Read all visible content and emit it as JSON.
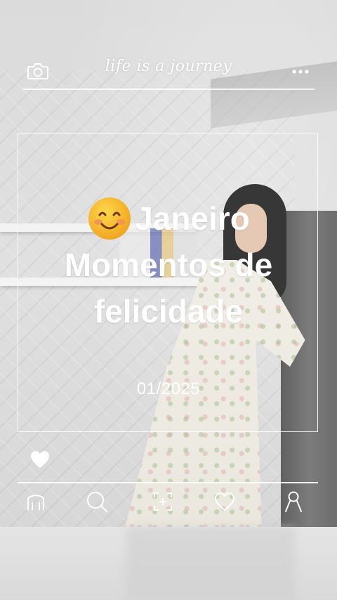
{
  "header": {
    "title": "life is a journey",
    "left_icon": "camera-icon",
    "right_icon": "more-dots-icon"
  },
  "card": {
    "emoji": "smiling-face-emoji",
    "title_line1": "Janeiro",
    "title_line2": "Momentos de",
    "title_line3": "felicidade",
    "date": "01/2025"
  },
  "actions": {
    "like_icon": "heart-icon"
  },
  "bottom_nav": {
    "items": [
      {
        "icon": "home-icon"
      },
      {
        "icon": "search-icon"
      },
      {
        "icon": "add-scan-icon"
      },
      {
        "icon": "favorites-heart-icon"
      },
      {
        "icon": "profile-icon"
      }
    ]
  },
  "colors": {
    "overlay_text": "#ffffff",
    "emoji_yellow": "#f6b82a",
    "emoji_cheek": "#f08a5d"
  }
}
